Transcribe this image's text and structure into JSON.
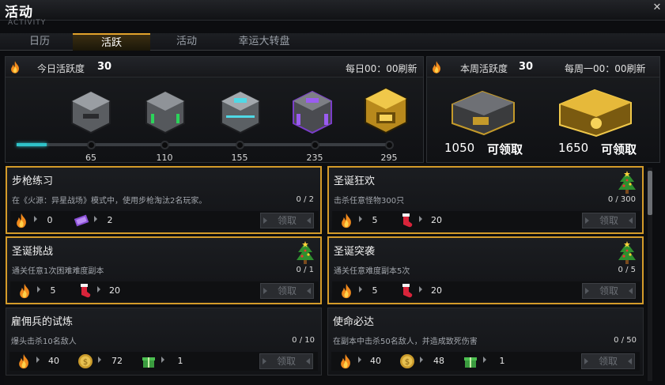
{
  "window": {
    "title": "活动",
    "subtitle": "ACTIVITY"
  },
  "tabs": [
    {
      "label": "日历"
    },
    {
      "label": "活跃",
      "active": true
    },
    {
      "label": "活动"
    },
    {
      "label": "幸运大转盘"
    }
  ],
  "daily": {
    "label": "今日活跃度",
    "value": "30",
    "refresh": "每日00：00刷新",
    "progress_fraction": 0.08,
    "milestones": [
      {
        "label": "65",
        "tier": "gray"
      },
      {
        "label": "110",
        "tier": "green"
      },
      {
        "label": "155",
        "tier": "cyan"
      },
      {
        "label": "235",
        "tier": "purple"
      },
      {
        "label": "295",
        "tier": "gold"
      }
    ]
  },
  "weekly": {
    "label": "本周活跃度",
    "value": "30",
    "refresh": "每周一00：00刷新",
    "rewards": [
      {
        "threshold": "1050",
        "claim_label": "可领取",
        "tier": "silver"
      },
      {
        "threshold": "1650",
        "claim_label": "可领取",
        "tier": "gold"
      }
    ]
  },
  "quests": [
    {
      "title": "步枪练习",
      "desc": "在《火源：异星战场》模式中，使用步枪淘汰2名玩家。",
      "progress": "0 / 2",
      "highlighted": true,
      "tree": false,
      "rewards": [
        {
          "icon": "flame-icon",
          "value": "0"
        },
        {
          "icon": "ticket-icon",
          "value": "2"
        }
      ],
      "claim": "领取"
    },
    {
      "title": "圣诞狂欢",
      "desc": "击杀任意怪物300只",
      "progress": "0 / 300",
      "highlighted": true,
      "tree": true,
      "rewards": [
        {
          "icon": "flame-icon",
          "value": "5"
        },
        {
          "icon": "stocking-icon",
          "value": "20"
        }
      ],
      "claim": "领取"
    },
    {
      "title": "圣诞挑战",
      "desc": "通关任意1次困难难度副本",
      "progress": "0 / 1",
      "highlighted": true,
      "tree": true,
      "rewards": [
        {
          "icon": "flame-icon",
          "value": "5"
        },
        {
          "icon": "stocking-icon",
          "value": "20"
        }
      ],
      "claim": "领取"
    },
    {
      "title": "圣诞突袭",
      "desc": "通关任意难度副本5次",
      "progress": "0 / 5",
      "highlighted": true,
      "tree": true,
      "rewards": [
        {
          "icon": "flame-icon",
          "value": "5"
        },
        {
          "icon": "stocking-icon",
          "value": "20"
        }
      ],
      "claim": "领取"
    },
    {
      "title": "雇佣兵的试炼",
      "desc": "爆头击杀10名敌人",
      "progress": "0 / 10",
      "highlighted": false,
      "tree": false,
      "rewards": [
        {
          "icon": "flame-icon",
          "value": "40"
        },
        {
          "icon": "coin-icon",
          "value": "72"
        },
        {
          "icon": "giftbox-icon",
          "value": "1"
        }
      ],
      "claim": "领取"
    },
    {
      "title": "使命必达",
      "desc": "在副本中击杀50名敌人，并造成致死伤害",
      "progress": "0 / 50",
      "highlighted": false,
      "tree": false,
      "rewards": [
        {
          "icon": "flame-icon",
          "value": "40"
        },
        {
          "icon": "coin-icon",
          "value": "48"
        },
        {
          "icon": "giftbox-icon",
          "value": "1"
        }
      ],
      "claim": "领取"
    }
  ],
  "colors": {
    "accent": "#d49b2a",
    "progress": "#2fc3c9",
    "panel": "#16181b"
  }
}
